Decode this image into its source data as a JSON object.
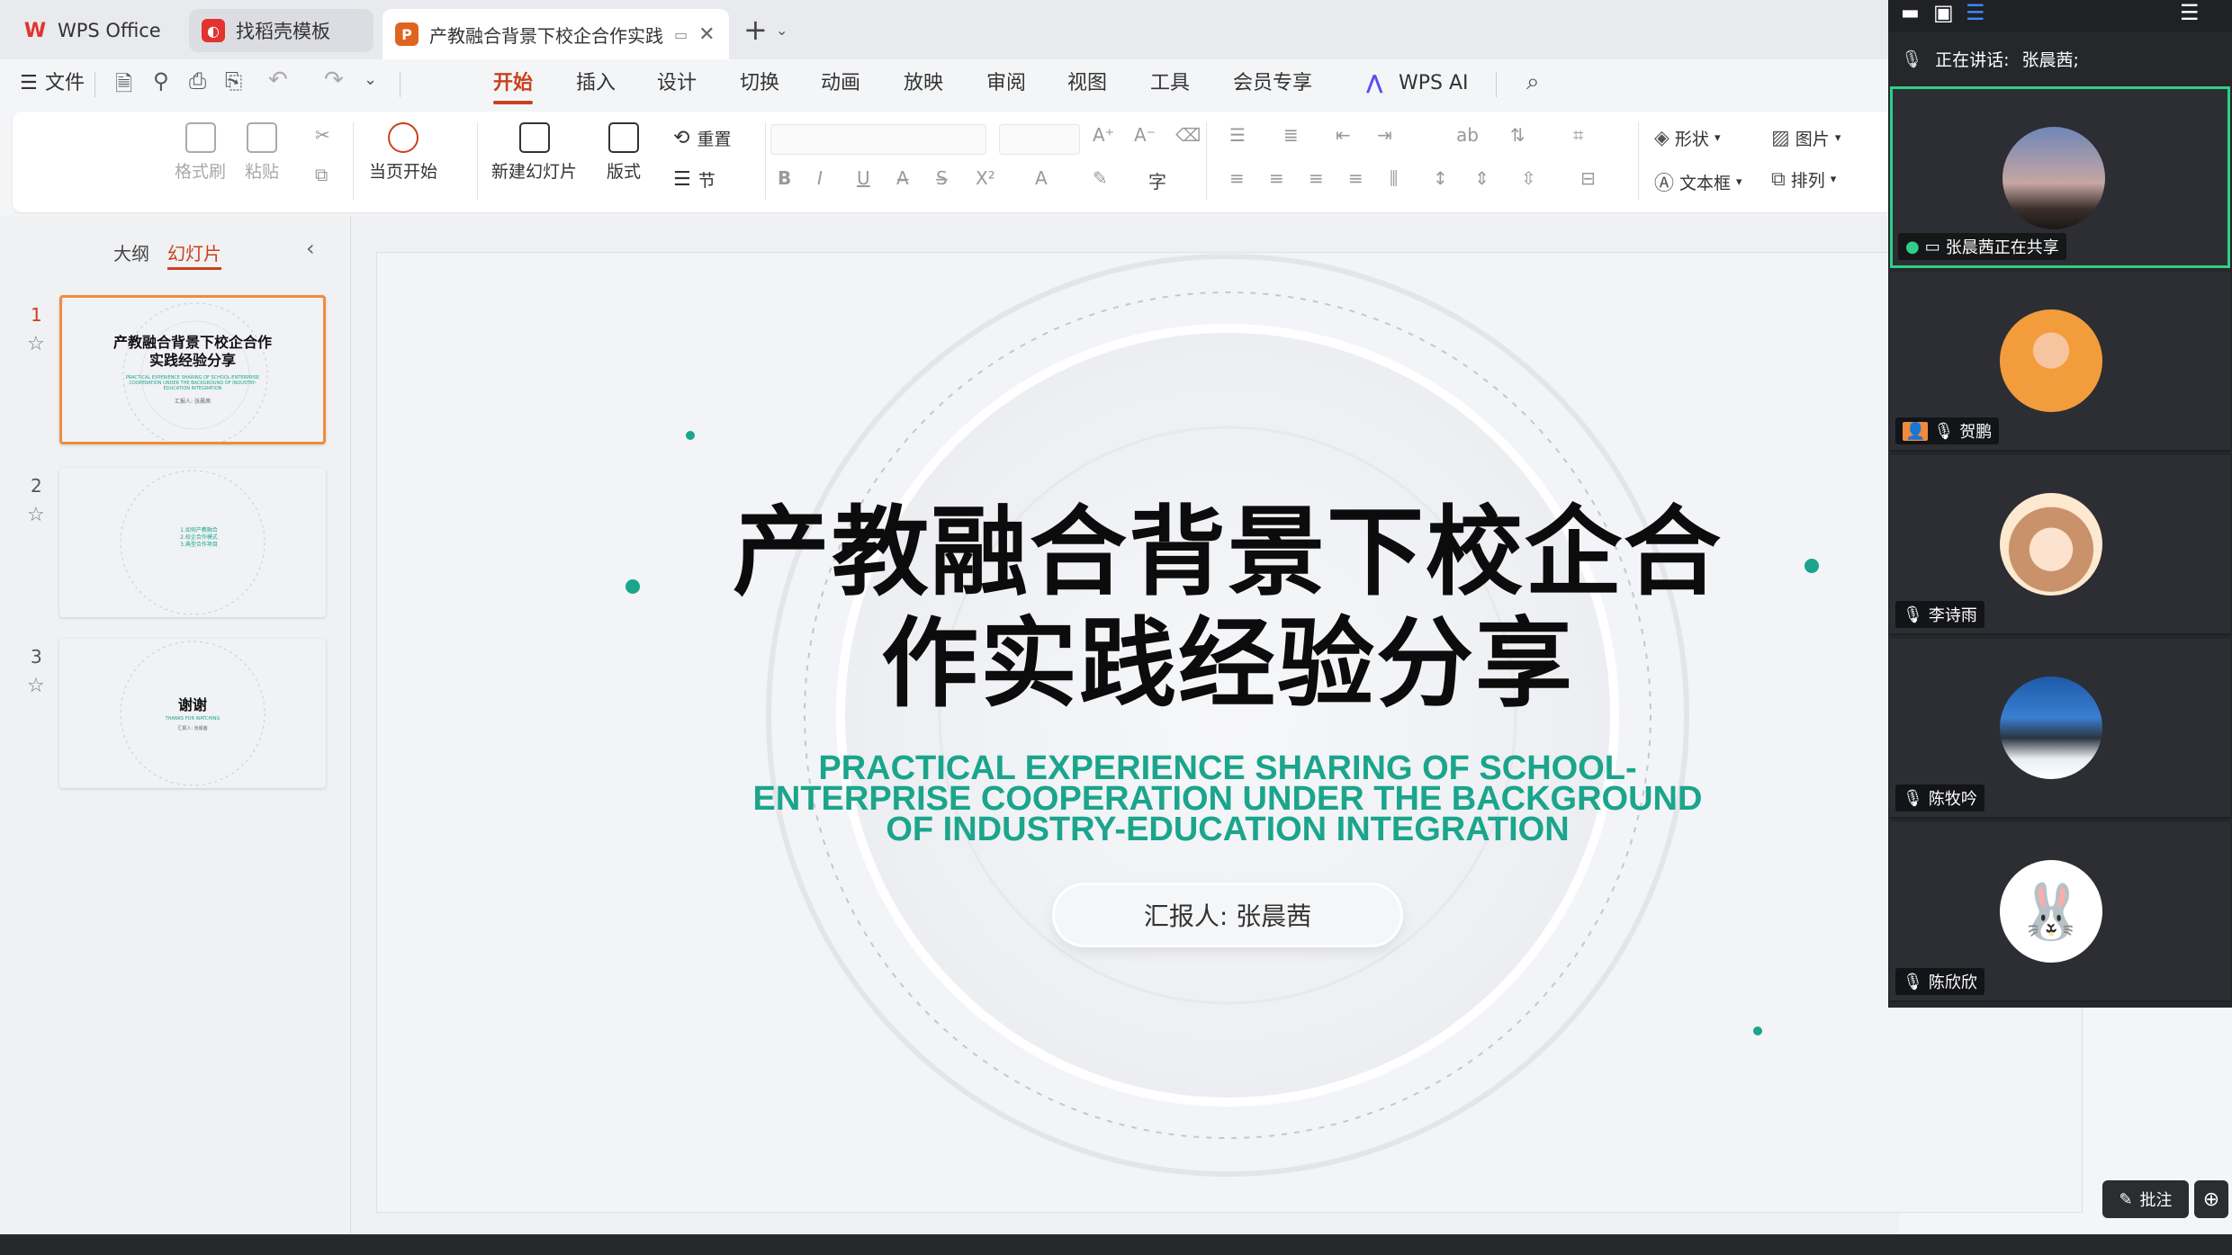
{
  "tabs": [
    {
      "label": "WPS Office",
      "icon": "wps-logo-icon"
    },
    {
      "label": "找稻壳模板",
      "icon": "docer-icon"
    },
    {
      "label": "产教融合背景下校企合作实践",
      "icon": "presentation-p-icon"
    }
  ],
  "menu": {
    "file": "文件",
    "items": [
      "开始",
      "插入",
      "设计",
      "切换",
      "动画",
      "放映",
      "审阅",
      "视图",
      "工具",
      "会员专享",
      "WPS AI"
    ],
    "selected": "开始"
  },
  "ribbon": {
    "format_painter": "格式刷",
    "paste": "粘贴",
    "from_current": "当页开始",
    "new_slide": "新建幻灯片",
    "layout": "版式",
    "reset": "重置",
    "section": "节",
    "shape": "形状",
    "picture": "图片",
    "textbox": "文本框",
    "arrange": "排列"
  },
  "leftpanel": {
    "outline": "大纲",
    "slides": "幻灯片",
    "thumbs": [
      {
        "num": "1",
        "title": "产教融合背景下校企合作实践经验分享",
        "sub": "PRACTICAL EXPERIENCE SHARING OF SCHOOL-ENTERPRISE COOPERATION UNDER THE BACKGROUND OF INDUSTRY-EDUCATION INTEGRATION",
        "reporter": "汇报人: 张晨茜"
      },
      {
        "num": "2",
        "lines": [
          "1.如何产教融合",
          "2.校企合作模式",
          "3.典型合作项目"
        ]
      },
      {
        "num": "3",
        "title": "谢谢",
        "sub": "THANKS FOR WATCHING",
        "reporter": "汇报人: 张晨茜"
      }
    ]
  },
  "slide": {
    "title_line1": "产教融合背景下校企合",
    "title_line2": "作实践经验分享",
    "subtitle": "PRACTICAL EXPERIENCE SHARING OF SCHOOL-ENTERPRISE COOPERATION UNDER THE BACKGROUND OF INDUSTRY-EDUCATION INTEGRATION",
    "reporter": "汇报人: 张晨茜"
  },
  "meeting": {
    "speaking_label": "正在讲话:",
    "speaking_name": "张晨茜;",
    "participants": [
      {
        "name": "张晨茜正在共享",
        "avatar": "sunset-avatar"
      },
      {
        "name": "贺鹏",
        "avatar": "cartoon-kid-avatar"
      },
      {
        "name": "李诗雨",
        "avatar": "cartoon-girl-avatar"
      },
      {
        "name": "陈牧吟",
        "avatar": "mountain-avatar"
      },
      {
        "name": "陈欣欣",
        "avatar": "bunny-avatar"
      }
    ]
  },
  "annotate": "批注",
  "colors": {
    "accent": "#c9411d",
    "teal": "#1aa58c",
    "active_border": "#2fcf87"
  }
}
